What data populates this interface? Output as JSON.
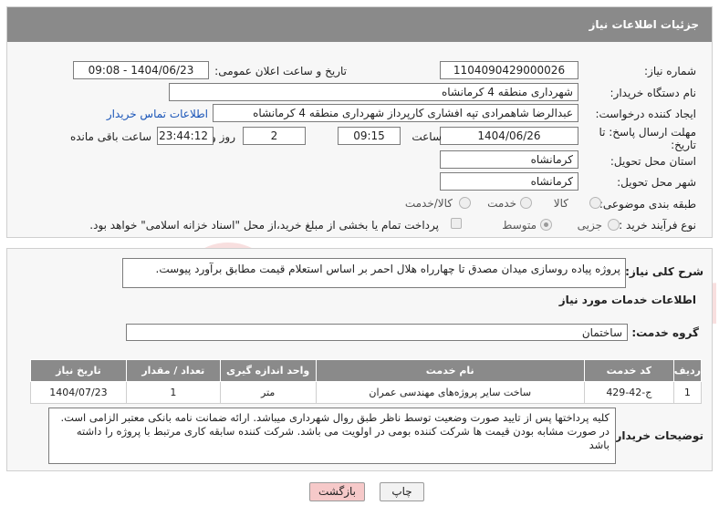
{
  "header": {
    "title": "جزئیات اطلاعات نیاز"
  },
  "fields": {
    "need_number_label": "شماره نیاز:",
    "need_number": "1104090429000026",
    "announce_label": "تاریخ و ساعت اعلان عمومی:",
    "announce_value": "1404/06/23 - 09:08",
    "buyer_org_label": "نام دستگاه خریدار:",
    "buyer_org": "شهرداری منطقه 4 کرمانشاه",
    "creator_label": "ایجاد کننده درخواست:",
    "creator": "عبدالرضا شاهمرادی تپه افشاری کارپرداز شهرداری منطقه 4 کرمانشاه",
    "contact_link": "اطلاعات تماس خریدار",
    "deadline_label": "مهلت ارسال پاسخ: تا تاریخ:",
    "deadline_date": "1404/06/26",
    "time_label": "ساعت",
    "deadline_time": "09:15",
    "days_value": "2",
    "days_label": "روز و",
    "remaining_time": "23:44:12",
    "remaining_label": "ساعت باقی مانده",
    "province_label": "استان محل تحویل:",
    "province": "کرمانشاه",
    "city_label": "شهر محل تحویل:",
    "city": "کرمانشاه",
    "category_label": "طبقه بندی موضوعی:",
    "category_options": [
      "کالا",
      "خدمت",
      "کالا/خدمت"
    ],
    "process_label": "نوع فرآیند خرید :",
    "process_options": [
      "جزیی",
      "متوسط"
    ],
    "payment_text": "پرداخت تمام یا بخشی از مبلغ خرید،از محل \"اسناد خزانه اسلامی\" خواهد بود."
  },
  "description": {
    "label": "شرح کلی نیاز:",
    "text": "پروژه پیاده روسازی میدان مصدق تا چهارراه هلال احمر بر اساس استعلام قیمت مطابق برآورد پیوست."
  },
  "services": {
    "section_title": "اطلاعات خدمات مورد نیاز",
    "group_label": "گروه خدمت:",
    "group_value": "ساختمان",
    "columns": [
      "ردیف",
      "کد خدمت",
      "نام خدمت",
      "واحد اندازه گیری",
      "تعداد / مقدار",
      "تاریخ نیاز"
    ],
    "rows": [
      [
        "1",
        "ج-42-429",
        "ساخت سایر پروژه‌های مهندسی عمران",
        "متر",
        "1",
        "1404/07/23"
      ]
    ]
  },
  "buyer_notes": {
    "label": "توضیحات خریدار:",
    "text": "کلیه پرداختها پس از تایید صورت وضعیت توسط ناظر طبق روال شهرداری میباشد. ارائه ضمانت نامه بانکی معتبر الزامی است. در صورت مشابه بودن قیمت ها شرکت کننده بومی در اولویت می باشد. شرکت کننده سابقه کاری مرتبط با پروژه را داشته باشد"
  },
  "buttons": {
    "print": "چاپ",
    "back": "بازگشت"
  },
  "watermark": {
    "text": "AriaTender.net"
  },
  "colors": {
    "header_bg": "#8a8a8a",
    "link": "#1a55b8",
    "back_btn": "#f6c9c9",
    "print_btn": "#f2f2f2"
  }
}
